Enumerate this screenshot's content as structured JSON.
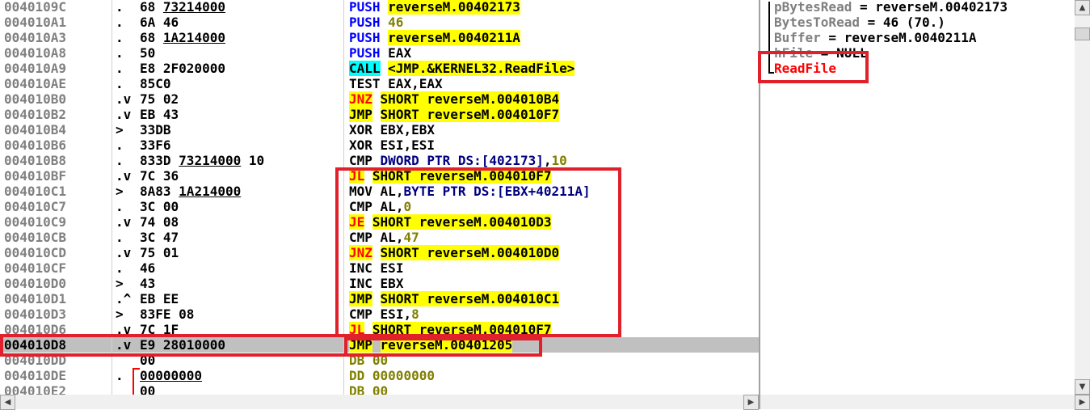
{
  "disasm": [
    {
      "addr": "0040109C",
      "flow": ".",
      "hex": [
        {
          "t": "68 "
        },
        {
          "t": "73214000",
          "u": true
        }
      ],
      "mn": "PUSH",
      "mk": "push",
      "ops": [
        {
          "t": "reverseM.00402173",
          "k": "hl"
        }
      ]
    },
    {
      "addr": "004010A1",
      "flow": ".",
      "hex": [
        {
          "t": "6A 46"
        }
      ],
      "mn": "PUSH",
      "mk": "push",
      "ops": [
        {
          "t": "46",
          "k": "num"
        }
      ]
    },
    {
      "addr": "004010A3",
      "flow": ".",
      "hex": [
        {
          "t": "68 "
        },
        {
          "t": "1A214000",
          "u": true
        }
      ],
      "mn": "PUSH",
      "mk": "push",
      "ops": [
        {
          "t": "reverseM.0040211A",
          "k": "hl"
        }
      ]
    },
    {
      "addr": "004010A8",
      "flow": ".",
      "hex": [
        {
          "t": "50"
        }
      ],
      "mn": "PUSH",
      "mk": "push",
      "ops": [
        {
          "t": "EAX",
          "k": "plain"
        }
      ]
    },
    {
      "addr": "004010A9",
      "flow": ".",
      "hex": [
        {
          "t": "E8 2F020000"
        }
      ],
      "mn": "CALL",
      "mk": "call",
      "ops": [
        {
          "t": "<JMP.&KERNEL32.ReadFile>",
          "k": "hl"
        }
      ]
    },
    {
      "addr": "004010AE",
      "flow": ".",
      "hex": [
        {
          "t": "85C0"
        }
      ],
      "mn": "TEST",
      "mk": "plain",
      "ops": [
        {
          "t": "EAX,EAX",
          "k": "plain"
        }
      ]
    },
    {
      "addr": "004010B0",
      "flow": ".v",
      "hex": [
        {
          "t": "75 02"
        }
      ],
      "mn": "JNZ",
      "mk": "jcc",
      "ops": [
        {
          "t": "SHORT reverseM.004010B4",
          "k": "hl"
        }
      ]
    },
    {
      "addr": "004010B2",
      "flow": ".v",
      "hex": [
        {
          "t": "EB 43"
        }
      ],
      "mn": "JMP",
      "mk": "jmp",
      "ops": [
        {
          "t": "SHORT reverseM.004010F7",
          "k": "hl"
        }
      ]
    },
    {
      "addr": "004010B4",
      "flow": ">",
      "hex": [
        {
          "t": "33DB"
        }
      ],
      "mn": "XOR",
      "mk": "plain",
      "ops": [
        {
          "t": "EBX,EBX",
          "k": "plain"
        }
      ]
    },
    {
      "addr": "004010B6",
      "flow": ".",
      "hex": [
        {
          "t": "33F6"
        }
      ],
      "mn": "XOR",
      "mk": "plain",
      "ops": [
        {
          "t": "ESI,ESI",
          "k": "plain"
        }
      ]
    },
    {
      "addr": "004010B8",
      "flow": ".",
      "hex": [
        {
          "t": "833D "
        },
        {
          "t": "73214000",
          "u": true
        },
        {
          "t": " 10"
        }
      ],
      "mn": "CMP",
      "mk": "plain",
      "ops": [
        {
          "t": "DWORD PTR DS:[402173]",
          "k": "mem"
        },
        {
          "t": ",",
          "k": "plain"
        },
        {
          "t": "10",
          "k": "num"
        }
      ]
    },
    {
      "addr": "004010BF",
      "flow": ".v",
      "hex": [
        {
          "t": "7C 36"
        }
      ],
      "mn": "JL",
      "mk": "jcc",
      "ops": [
        {
          "t": "SHORT reverseM.004010F7",
          "k": "hl"
        }
      ]
    },
    {
      "addr": "004010C1",
      "flow": ">",
      "hex": [
        {
          "t": "8A83 "
        },
        {
          "t": "1A214000",
          "u": true
        }
      ],
      "mn": "MOV",
      "mk": "plain",
      "ops": [
        {
          "t": "AL,",
          "k": "plain"
        },
        {
          "t": "BYTE PTR DS:[EBX+40211A]",
          "k": "mem"
        }
      ]
    },
    {
      "addr": "004010C7",
      "flow": ".",
      "hex": [
        {
          "t": "3C 00"
        }
      ],
      "mn": "CMP",
      "mk": "plain",
      "ops": [
        {
          "t": "AL,",
          "k": "plain"
        },
        {
          "t": "0",
          "k": "num"
        }
      ]
    },
    {
      "addr": "004010C9",
      "flow": ".v",
      "hex": [
        {
          "t": "74 08"
        }
      ],
      "mn": "JE",
      "mk": "jcc",
      "ops": [
        {
          "t": "SHORT reverseM.004010D3",
          "k": "hl"
        }
      ]
    },
    {
      "addr": "004010CB",
      "flow": ".",
      "hex": [
        {
          "t": "3C 47"
        }
      ],
      "mn": "CMP",
      "mk": "plain",
      "ops": [
        {
          "t": "AL,",
          "k": "plain"
        },
        {
          "t": "47",
          "k": "num"
        }
      ]
    },
    {
      "addr": "004010CD",
      "flow": ".v",
      "hex": [
        {
          "t": "75 01"
        }
      ],
      "mn": "JNZ",
      "mk": "jcc",
      "ops": [
        {
          "t": "SHORT reverseM.004010D0",
          "k": "hl"
        }
      ]
    },
    {
      "addr": "004010CF",
      "flow": ".",
      "hex": [
        {
          "t": "46"
        }
      ],
      "mn": "INC",
      "mk": "plain",
      "ops": [
        {
          "t": "ESI",
          "k": "plain"
        }
      ]
    },
    {
      "addr": "004010D0",
      "flow": ">",
      "hex": [
        {
          "t": "43"
        }
      ],
      "mn": "INC",
      "mk": "plain",
      "ops": [
        {
          "t": "EBX",
          "k": "plain"
        }
      ]
    },
    {
      "addr": "004010D1",
      "flow": ".^",
      "hex": [
        {
          "t": "EB EE"
        }
      ],
      "mn": "JMP",
      "mk": "jmp",
      "ops": [
        {
          "t": "SHORT reverseM.004010C1",
          "k": "hl"
        }
      ]
    },
    {
      "addr": "004010D3",
      "flow": ">",
      "hex": [
        {
          "t": "83FE 08"
        }
      ],
      "mn": "CMP",
      "mk": "plain",
      "ops": [
        {
          "t": "ESI,",
          "k": "plain"
        },
        {
          "t": "8",
          "k": "num"
        }
      ]
    },
    {
      "addr": "004010D6",
      "flow": ".v",
      "hex": [
        {
          "t": "7C 1F"
        }
      ],
      "mn": "JL",
      "mk": "jcc",
      "ops": [
        {
          "t": "SHORT reverseM.004010F7",
          "k": "hl"
        }
      ]
    },
    {
      "addr": "004010D8",
      "flow": ".v",
      "hex": [
        {
          "t": "E9 28010000"
        }
      ],
      "mn": "JMP",
      "mk": "jmp",
      "ops": [
        {
          "t": "reverseM.00401205",
          "k": "hl"
        }
      ],
      "selected": true
    },
    {
      "addr": "004010DD",
      "flow": "",
      "hex": [
        {
          "t": "00"
        }
      ],
      "mn": "DB",
      "mk": "data",
      "ops": [
        {
          "t": "00",
          "k": "num"
        }
      ]
    },
    {
      "addr": "004010DE",
      "flow": ".",
      "hex": [
        {
          "t": "00000000",
          "u": true
        }
      ],
      "mn": "DD",
      "mk": "data",
      "ops": [
        {
          "t": "00000000",
          "k": "num"
        }
      ]
    },
    {
      "addr": "004010E2",
      "flow": "",
      "hex": [
        {
          "t": "00"
        }
      ],
      "mn": "DB",
      "mk": "data",
      "ops": [
        {
          "t": "00",
          "k": "num"
        }
      ]
    }
  ],
  "comments": [
    {
      "name": "pBytesRead",
      "value": " = reverseM.00402173"
    },
    {
      "name": "BytesToRead",
      "value": " = 46 (70.)"
    },
    {
      "name": "Buffer",
      "value": " = reverseM.0040211A"
    },
    {
      "name": "hFile",
      "value": " = NULL"
    },
    {
      "name": "ReadFile",
      "value": "",
      "red": true
    }
  ]
}
